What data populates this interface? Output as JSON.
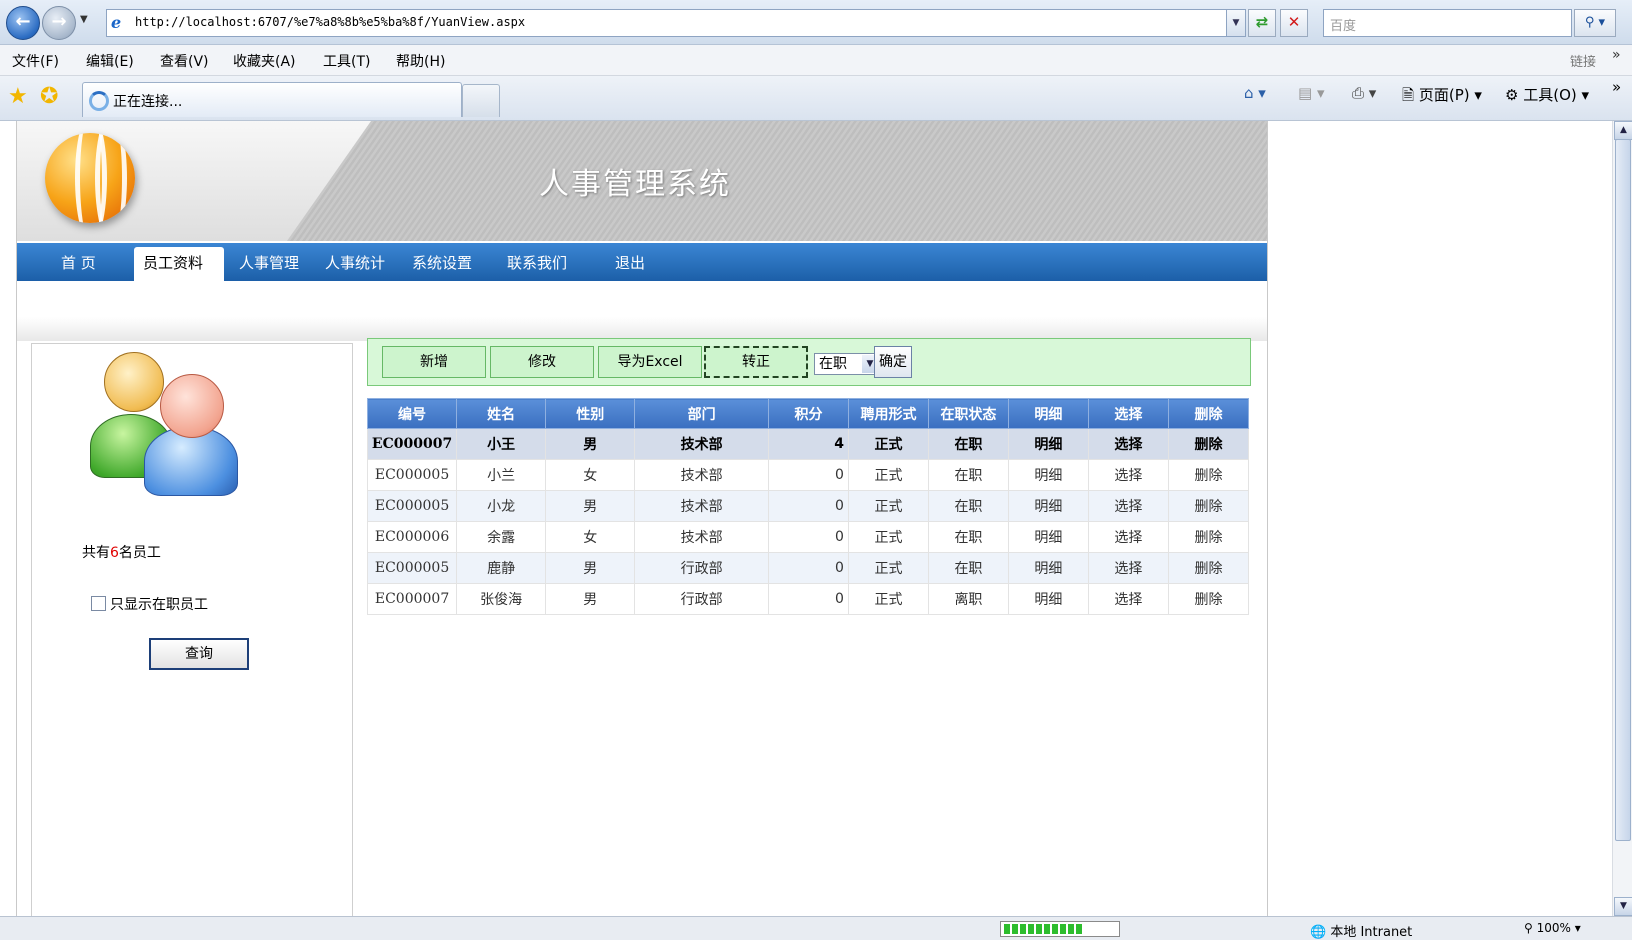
{
  "browser": {
    "url": "http://localhost:6707/%e7%a8%8b%e5%ba%8f/YuanView.aspx",
    "search_placeholder": "百度",
    "menu": [
      "文件(F)",
      "编辑(E)",
      "查看(V)",
      "收藏夹(A)",
      "工具(T)",
      "帮助(H)"
    ],
    "links_label": "链接",
    "tab_title": "正在连接...",
    "toolbar": {
      "page_label": "页面(P)",
      "tools_label": "工具(O)"
    },
    "status": {
      "zone": "本地 Intranet",
      "zoom": "100%"
    }
  },
  "site": {
    "title": "人事管理系统",
    "nav": {
      "home": "首 页",
      "employee": "员工资料",
      "hr_manage": "人事管理",
      "hr_stats": "人事统计",
      "settings": "系统设置",
      "contact": "联系我们",
      "logout": "退出"
    },
    "sidebar": {
      "count_prefix": "共有",
      "count_value": "6",
      "count_suffix": "名员工",
      "only_active_label": "只显示在职员工",
      "query_button": "查询"
    },
    "actions": {
      "add": "新增",
      "edit": "修改",
      "export": "导为Excel",
      "regularize": "转正",
      "status_selected": "在职",
      "confirm": "确定"
    },
    "table": {
      "headers": [
        "编号",
        "姓名",
        "性别",
        "部门",
        "积分",
        "聘用形式",
        "在职状态",
        "明细",
        "选择",
        "删除"
      ],
      "rows": [
        [
          "EC000007",
          "小王",
          "男",
          "技术部",
          "4",
          "正式",
          "在职",
          "明细",
          "选择",
          "删除"
        ],
        [
          "EC000005",
          "小兰",
          "女",
          "技术部",
          "0",
          "正式",
          "在职",
          "明细",
          "选择",
          "删除"
        ],
        [
          "EC000005",
          "小龙",
          "男",
          "技术部",
          "0",
          "正式",
          "在职",
          "明细",
          "选择",
          "删除"
        ],
        [
          "EC000006",
          "余露",
          "女",
          "技术部",
          "0",
          "正式",
          "在职",
          "明细",
          "选择",
          "删除"
        ],
        [
          "EC000005",
          "鹿静",
          "男",
          "行政部",
          "0",
          "正式",
          "在职",
          "明细",
          "选择",
          "删除"
        ],
        [
          "EC000007",
          "张俊海",
          "男",
          "行政部",
          "0",
          "正式",
          "离职",
          "明细",
          "选择",
          "删除"
        ]
      ]
    }
  },
  "colors": {
    "nav_blue": "#2a72c2",
    "table_header": "#4a7fcc",
    "toolbar_green": "#d8f8d8",
    "count_red": "#e00000"
  }
}
